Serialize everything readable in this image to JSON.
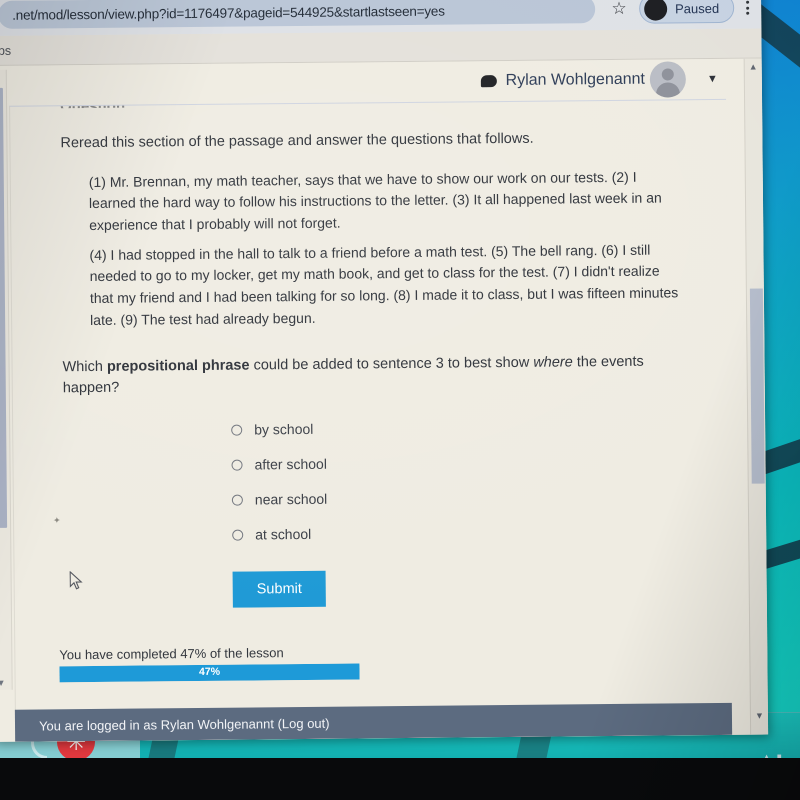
{
  "browser": {
    "url": ".net/mod/lesson/view.php?id=1176497&pageid=544925&startlastseen=yes",
    "star_icon": "star-icon",
    "profile_label": "Paused",
    "menu_icon": "three-dot-menu-icon",
    "bookmarks": [
      {
        "label": "Maps"
      }
    ]
  },
  "page_header": {
    "chat_icon": "speech-bubble-icon",
    "user_name": "Rylan Wohlgenannt",
    "avatar": "user-avatar",
    "caret_icon": "chevron-down-icon"
  },
  "lesson": {
    "section_heading": "Question",
    "intro": "Reread this section of the passage and answer the questions that follows.",
    "passage": [
      "(1) Mr. Brennan, my math teacher, says that we have to show our work on our tests. (2) I learned the hard way to follow his instructions to the letter. (3) It all happened last week in an experience that I probably will not forget.",
      "(4) I had stopped in the hall to talk to a friend before a math test. (5) The bell rang. (6) I still needed to go to my locker, get my math book, and get to class for the test. (7) I didn't realize that my friend and I had been talking for so long. (8) I made it to class, but I was fifteen minutes late. (9) The test had already begun."
    ],
    "question": {
      "part1": "Which ",
      "bold": "prepositional phrase",
      "part2": " could be added to sentence 3 to best show ",
      "italic": "where",
      "part3": " the events happen?"
    },
    "options": [
      {
        "label": "by school",
        "selected": false
      },
      {
        "label": "after school",
        "selected": false
      },
      {
        "label": "near school",
        "selected": false
      },
      {
        "label": "at school",
        "selected": false
      }
    ],
    "submit_label": "Submit",
    "progress": {
      "label": "You have completed 47% of the lesson",
      "value_label": "47%",
      "percent": 47
    },
    "footer": "You are logged in as Rylan Wohlgenannt (Log out)"
  },
  "scrollbars": {
    "up_arrow": "▲",
    "down_arrow": "▼"
  },
  "desktop": {
    "taskbar_icon": "red-pinwheel-app-icon",
    "taskbar_icon_glyph": "✳",
    "tray_arrows": "▲▮"
  },
  "colors": {
    "accent_blue": "#1f9ad6",
    "progress_blue": "#1e9ad8",
    "footer_bar": "#5c6b80",
    "page_bg": "#efece2",
    "omnibox": "#b9c5d6",
    "taskbar_icon_red": "#e0383e"
  }
}
